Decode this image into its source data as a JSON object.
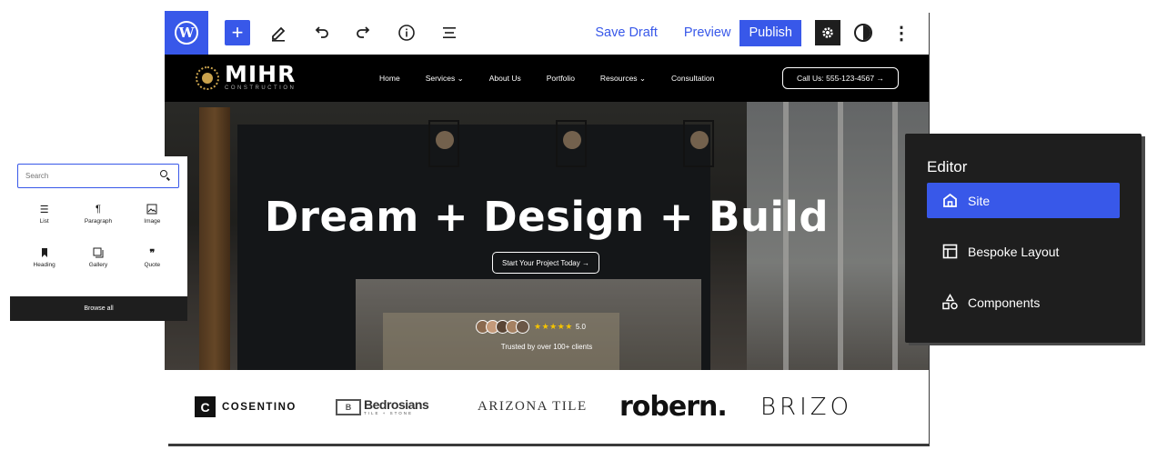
{
  "toolbar": {
    "save_draft": "Save Draft",
    "preview": "Preview",
    "publish": "Publish"
  },
  "site": {
    "brand_name": "MIHR",
    "brand_sub": "CONSTRUCTION",
    "nav": [
      "Home",
      "Services ⌄",
      "About Us",
      "Portfolio",
      "Resources ⌄",
      "Consultation"
    ],
    "call": "Call Us: 555-123-4567 →"
  },
  "hero": {
    "title": "Dream + Design + Build",
    "cta": "Start Your Project Today →",
    "stars": "★★★★★",
    "score": "5.0",
    "trusted": "Trusted by over 100+ clients"
  },
  "logos": {
    "cosentino_mark": "C",
    "cosentino": "COSENTINO",
    "bedrosians_mark": "B",
    "bedrosians": "Bedrosians",
    "bedrosians_sub": "TILE + STONE",
    "arizona": "ARIZONA TILE",
    "robern": "robern.",
    "brizo": "BRIZO"
  },
  "inserter": {
    "search_placeholder": "Search",
    "blocks": [
      {
        "label": "List",
        "icon": "list-icon"
      },
      {
        "label": "Paragraph",
        "icon": "paragraph-icon"
      },
      {
        "label": "Image",
        "icon": "image-icon"
      },
      {
        "label": "Heading",
        "icon": "bookmark-icon"
      },
      {
        "label": "Gallery",
        "icon": "gallery-icon"
      },
      {
        "label": "Quote",
        "icon": "quote-icon"
      }
    ],
    "browse_all": "Browse all"
  },
  "side_panel": {
    "title": "Editor",
    "items": [
      {
        "label": "Site",
        "icon": "home-icon"
      },
      {
        "label": "Bespoke Layout",
        "icon": "layout-icon"
      },
      {
        "label": "Components",
        "icon": "shapes-icon"
      }
    ]
  },
  "colors": {
    "accent": "#3858e9",
    "dark": "#1e1e1e",
    "star": "#f5c400"
  }
}
